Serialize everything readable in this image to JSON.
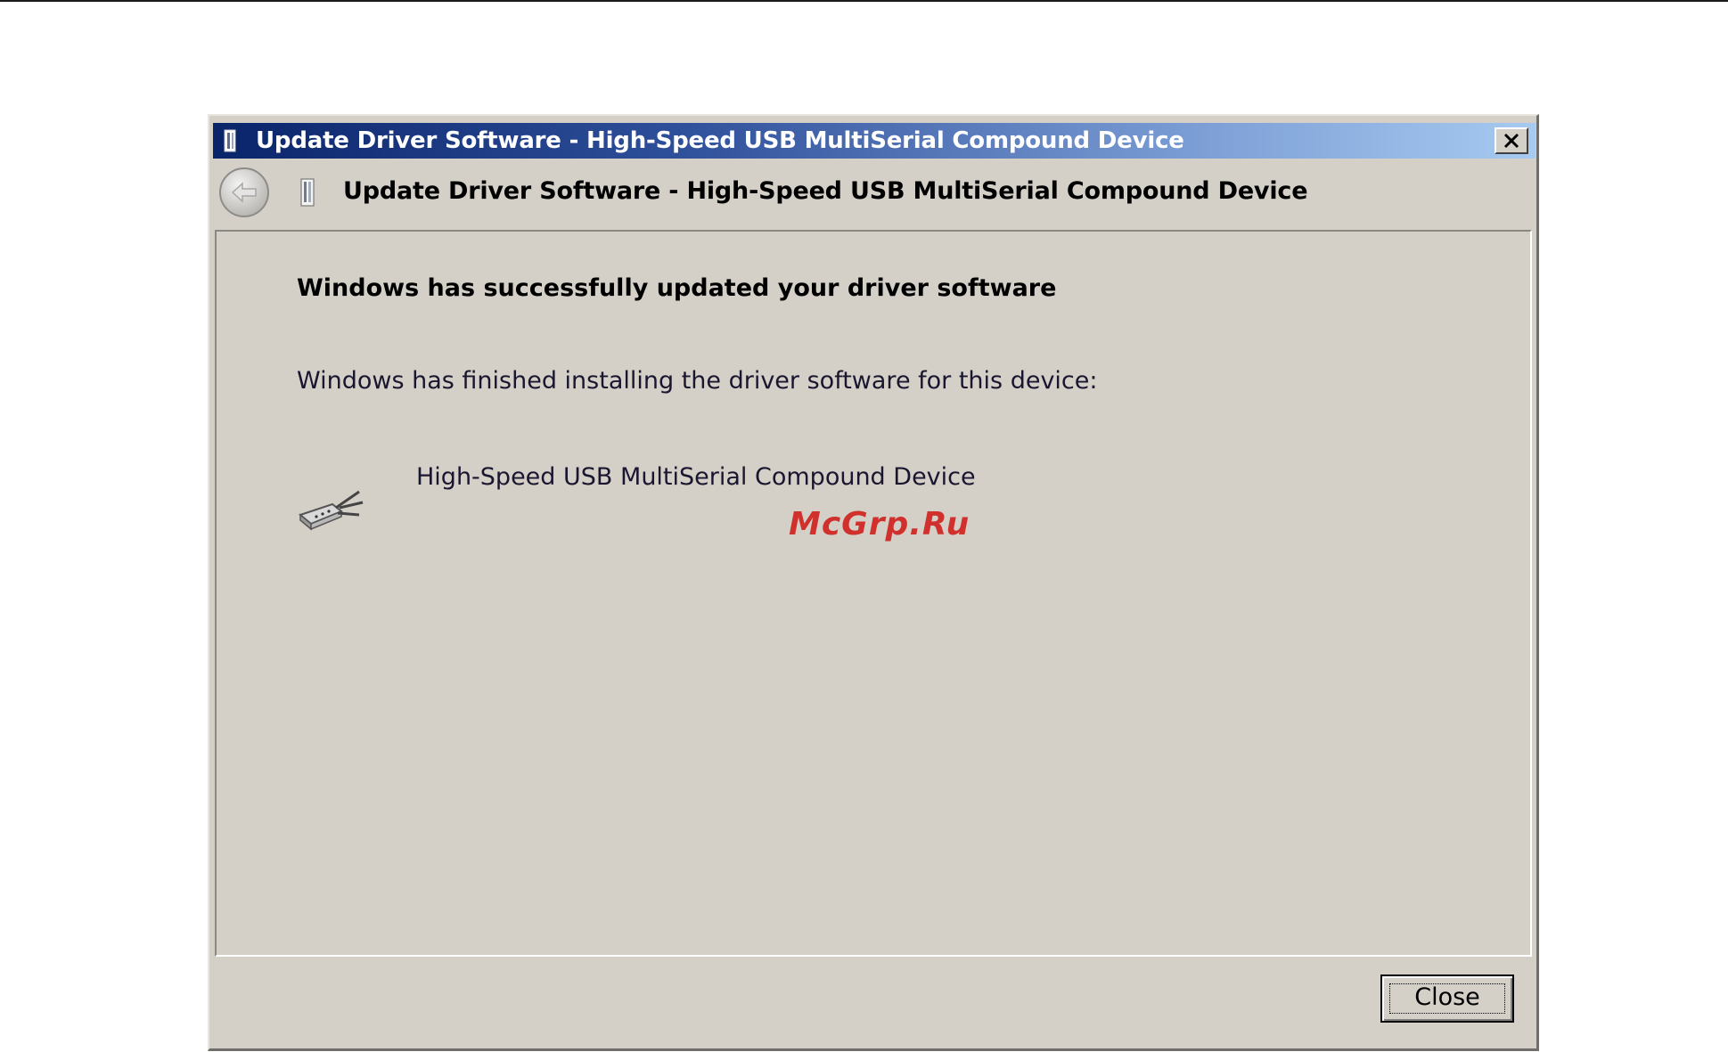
{
  "window": {
    "title": "Update Driver Software - High-Speed USB MultiSerial Compound Device",
    "close_glyph": "✕"
  },
  "header": {
    "title": "Update Driver Software - High-Speed USB MultiSerial Compound Device",
    "back_icon": "back-arrow-icon",
    "device_icon": "usb-device-icon"
  },
  "content": {
    "success_title": "Windows has successfully updated your driver software",
    "finished_text": "Windows has finished installing the driver software for this device:",
    "device_name": "High-Speed USB MultiSerial Compound Device",
    "device_icon": "serial-port-icon"
  },
  "watermark": {
    "text": "McGrp.Ru",
    "color": "#d0312d"
  },
  "footer": {
    "close_label": "Close"
  },
  "colors": {
    "dialog_background": "#d4d0c8",
    "titlebar_start": "#0a246a",
    "titlebar_end": "#a6caf0"
  }
}
